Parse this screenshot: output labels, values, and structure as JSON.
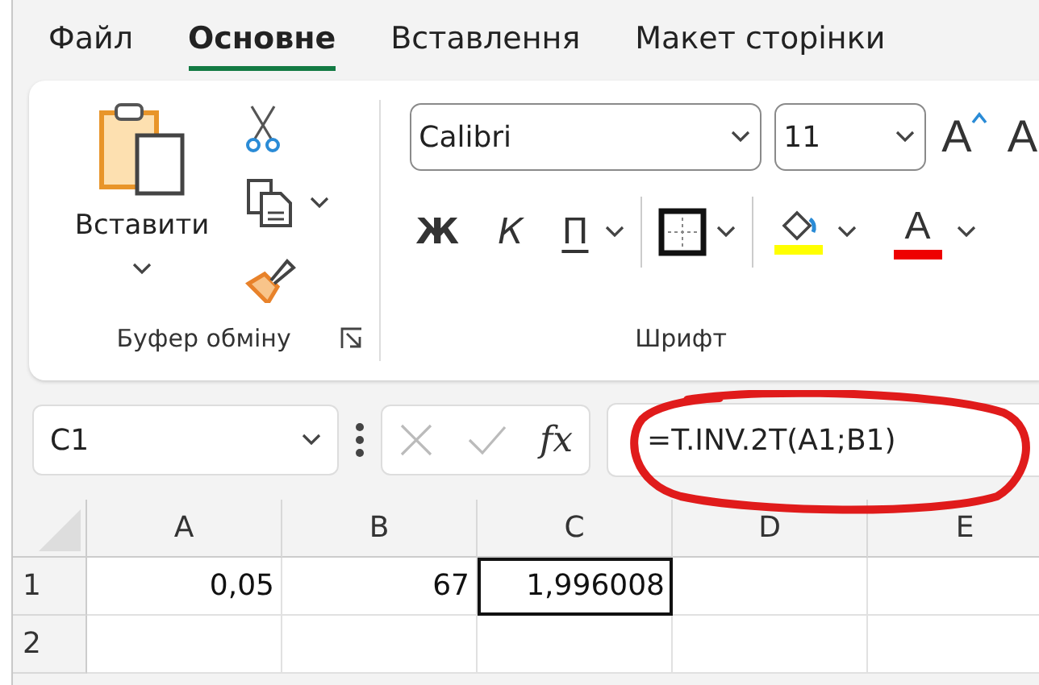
{
  "tabs": [
    {
      "label": "Файл",
      "selected": false
    },
    {
      "label": "Основне",
      "selected": true
    },
    {
      "label": "Вставлення",
      "selected": false
    },
    {
      "label": "Макет сторінки",
      "selected": false
    }
  ],
  "clipboard": {
    "paste_label": "Вставити",
    "group_label": "Буфер обміну"
  },
  "font": {
    "name": "Calibri",
    "size": "11",
    "grow": "A",
    "shrink": "A",
    "bold": "Ж",
    "italic": "К",
    "underline": "П",
    "font_color": "A",
    "group_label": "Шрифт"
  },
  "formula_bar": {
    "name_box": "C1",
    "fx": "fx",
    "formula": "=T.INV.2T(A1;B1)"
  },
  "sheet": {
    "columns": [
      "A",
      "B",
      "C",
      "D",
      "E"
    ],
    "rows": [
      {
        "header": "1",
        "cells": [
          {
            "value": "0,05",
            "selected": false
          },
          {
            "value": "67",
            "selected": false
          },
          {
            "value": "1,996008",
            "selected": true
          },
          {
            "selected": false
          },
          {
            "selected": false
          }
        ]
      },
      {
        "header": "2",
        "cells": [
          {
            "selected": false
          },
          {
            "selected": false
          },
          {
            "selected": false
          },
          {
            "selected": false
          },
          {
            "selected": false
          }
        ]
      }
    ]
  }
}
